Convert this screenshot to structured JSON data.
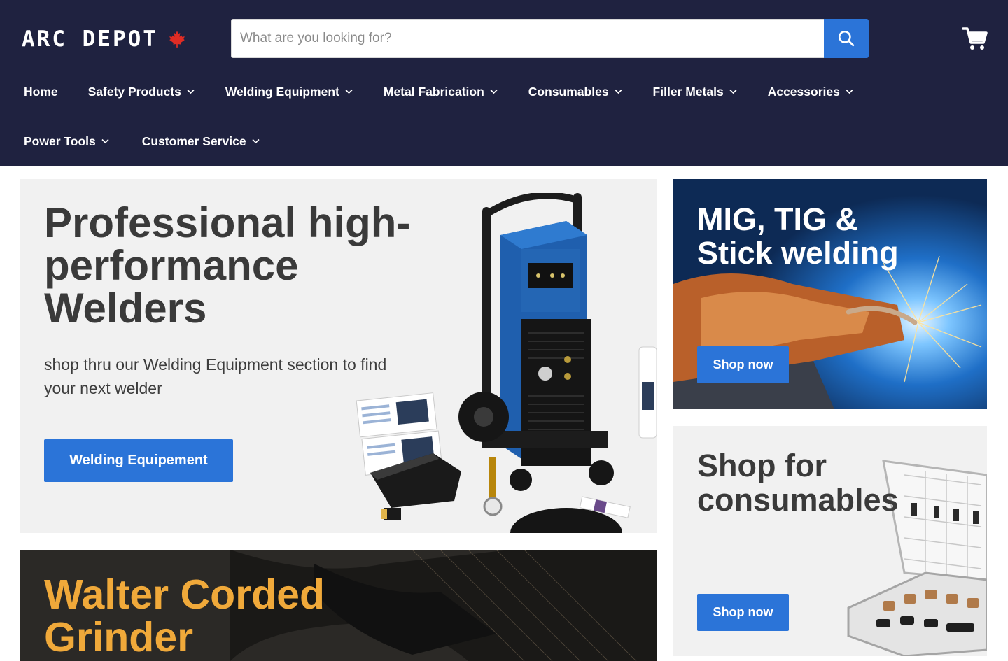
{
  "header": {
    "logo_text": "ARC DEPOT",
    "search_placeholder": "What are you looking for?",
    "accent_color": "#2b74d8",
    "background_color": "#1f2240"
  },
  "nav": {
    "row1": [
      {
        "label": "Home",
        "has_dropdown": false
      },
      {
        "label": "Safety Products",
        "has_dropdown": true
      },
      {
        "label": "Welding Equipment",
        "has_dropdown": true
      },
      {
        "label": "Metal Fabrication",
        "has_dropdown": true
      },
      {
        "label": "Consumables",
        "has_dropdown": true
      },
      {
        "label": "Filler Metals",
        "has_dropdown": true
      },
      {
        "label": "Accessories",
        "has_dropdown": true
      }
    ],
    "row2": [
      {
        "label": "Power Tools",
        "has_dropdown": true
      },
      {
        "label": "Customer Service",
        "has_dropdown": true
      }
    ]
  },
  "hero": {
    "title": "Professional high-performance Welders",
    "subtitle": "shop thru our Welding Equipment section to find your next welder",
    "button": "Welding Equipement"
  },
  "mig_card": {
    "title": "MIG, TIG & Stick welding",
    "button": "Shop now"
  },
  "consumables_card": {
    "title": "Shop for consumables",
    "button": "Shop now"
  },
  "walter_card": {
    "title": "Walter Corded Grinder",
    "title_color": "#f0a93a"
  },
  "icons": [
    "maple-leaf-icon",
    "search-icon",
    "cart-icon",
    "chevron-down-icon"
  ]
}
